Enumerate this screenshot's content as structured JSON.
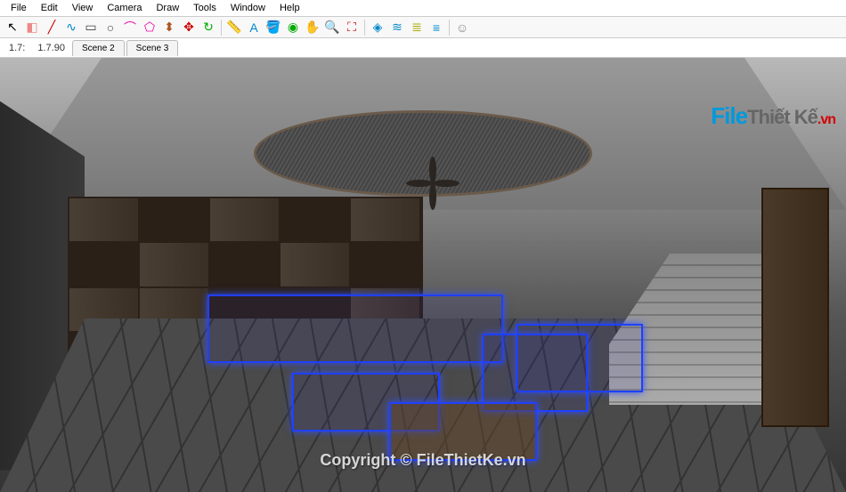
{
  "menubar": {
    "items": [
      "File",
      "Edit",
      "View",
      "Camera",
      "Draw",
      "Tools",
      "Window",
      "Help"
    ]
  },
  "toolbar": {
    "tools": [
      {
        "name": "select-tool",
        "glyph": "↖",
        "color": "#000"
      },
      {
        "name": "eraser-tool",
        "glyph": "◧",
        "color": "#e88"
      },
      {
        "name": "line-tool",
        "glyph": "╱",
        "color": "#c00"
      },
      {
        "name": "freehand-tool",
        "glyph": "∿",
        "color": "#08c"
      },
      {
        "name": "rectangle-tool",
        "glyph": "▭",
        "color": "#444"
      },
      {
        "name": "circle-tool",
        "glyph": "○",
        "color": "#444"
      },
      {
        "name": "arc-tool",
        "glyph": "⌒",
        "color": "#e0a"
      },
      {
        "name": "polygon-tool",
        "glyph": "⬠",
        "color": "#e0a"
      },
      {
        "name": "pushpull-tool",
        "glyph": "⬍",
        "color": "#a52"
      },
      {
        "name": "move-tool",
        "glyph": "✥",
        "color": "#c00"
      },
      {
        "name": "rotate-tool",
        "glyph": "↻",
        "color": "#0a0"
      },
      {
        "name": "sep1",
        "sep": true
      },
      {
        "name": "tape-tool",
        "glyph": "📏",
        "color": "#aa0"
      },
      {
        "name": "text-tool",
        "glyph": "A",
        "color": "#08c"
      },
      {
        "name": "paint-tool",
        "glyph": "🪣",
        "color": "#a52"
      },
      {
        "name": "orbit-tool",
        "glyph": "◉",
        "color": "#0a0"
      },
      {
        "name": "pan-tool",
        "glyph": "✋",
        "color": "#a52"
      },
      {
        "name": "zoom-tool",
        "glyph": "🔍",
        "color": "#08c"
      },
      {
        "name": "zoomextents-tool",
        "glyph": "⛶",
        "color": "#c00"
      },
      {
        "name": "sep2",
        "sep": true
      },
      {
        "name": "iso-tool",
        "glyph": "◈",
        "color": "#08c"
      },
      {
        "name": "layers-tool",
        "glyph": "≋",
        "color": "#08c"
      },
      {
        "name": "outliner-tool",
        "glyph": "≣",
        "color": "#aa0"
      },
      {
        "name": "settings-tool",
        "glyph": "≡",
        "color": "#08c"
      },
      {
        "name": "sep3",
        "sep": true
      },
      {
        "name": "profile-tool",
        "glyph": "☺",
        "color": "#888"
      }
    ]
  },
  "scenebar": {
    "label_left": "1.7:",
    "label_value": "1.7.90",
    "tabs": [
      {
        "label": "Scene 2",
        "active": false
      },
      {
        "label": "Scene 3",
        "active": false
      }
    ]
  },
  "watermark": {
    "logo_file": "File",
    "logo_thietke": "Thiết Kế",
    "logo_vn": ".vn",
    "center_text": "Copyright © FileThietKe.vn"
  },
  "viewport": {
    "scene_description": "Interior living room - dark wood shelving, tiled floor, ceiling fan under skylight panel, staircase right, selected furniture group (sofa, table, ottoman, armchairs) highlighted blue"
  }
}
